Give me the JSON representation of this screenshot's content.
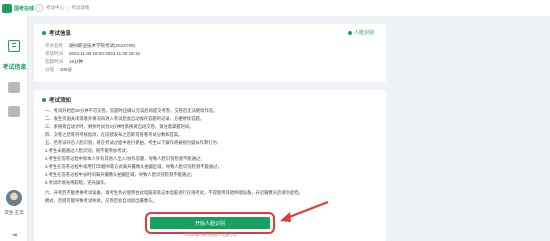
{
  "app": {
    "logo_text": "国考在线",
    "brand_color": "#19a05e",
    "accent_red": "#e53935"
  },
  "breadcrumb": {
    "back_glyph": "‹",
    "home": "考试中心",
    "separator": "/",
    "current": "考试详情"
  },
  "sidebar": {
    "active_label": "考试信息",
    "student_name": "李生 王丰",
    "logout_glyph": "⇥"
  },
  "exam_info": {
    "title": "考试信息",
    "face_status": "人脸识别",
    "rows": [
      {
        "k": "考试名称",
        "v": "湖州职业技术学院考试(2023Y09)"
      },
      {
        "k": "考试时间",
        "v": "2023.11.09 18:00-2023.11.09 18:15"
      },
      {
        "k": "答题时间",
        "v": "15分钟"
      },
      {
        "k": "分值",
        "v": "100分"
      }
    ]
  },
  "notice": {
    "title": "考试须知",
    "lines": [
      "一、考试开始后30分钟不可交卷，答题时应确认无误后再提交考卷，交卷后无法继续作答。",
      "二、发生页面关闭或意外情况再进入考试后会自动保存答题的记录，方便继续答题。",
      "三、系统将自动计时，剩余时间为0分钟时系统将自动交卷，请注意掌握时间。",
      "四、交卷之后等待考核批改，在成绩发布之后即可查看考试分数和答案。",
      "五、若考试开启人脸识别，将在考试过程中进行抓拍，考生以下操作将被视为疑似作弊行为：",
      "1.考生未能通过人脸识别，则不能参加考试；",
      "2.考生在答卷过程中除本人外有其他人出入/协作答题，导致人脸识别检测不能通过；",
      "3.考生在答卷过程中采用打印/翻书等方式离开摄像头拍摄区域，导致人脸识别检测不能通过；",
      "4.考生在答卷过程中长时间离开摄像头拍摄区域，导致人脸识别检测不能通过；",
      "5.考试环境光线较暗，逆光操作。",
      "六、开考后不能更换考试设备，请考生务必使用台式电脑或笔记本电脑进行在线考试，不得使用其他终端设备，开启摄像头后请勿遮挡。",
      "模式、否则可能导致考试失败，交卷后会自动退出摄像头。"
    ]
  },
  "actions": {
    "start_exam": "开始人脸识别",
    "hint": "考试前请先确认摄像头设备可用"
  }
}
